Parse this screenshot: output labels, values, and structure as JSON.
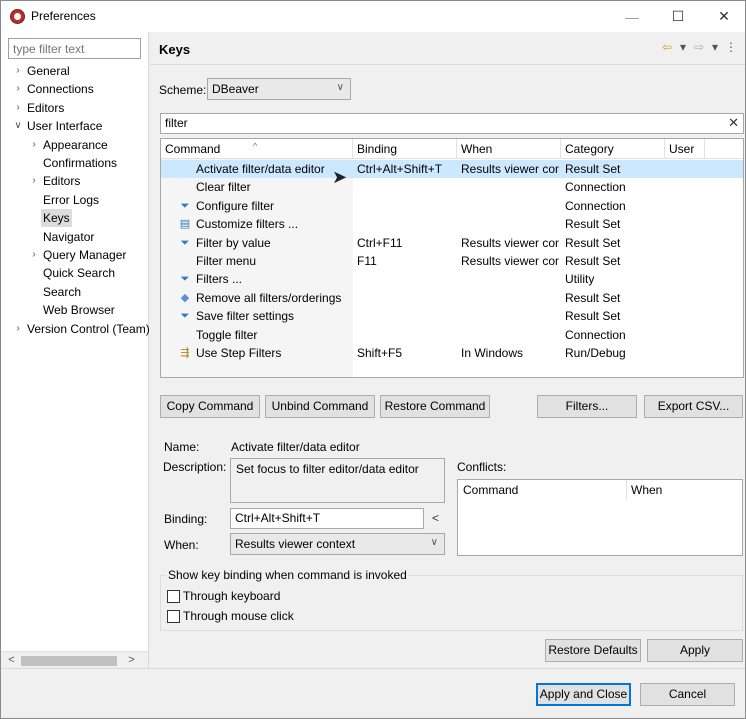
{
  "window": {
    "title": "Preferences"
  },
  "sidebar": {
    "filter_placeholder": "type filter text",
    "items": [
      {
        "label": "General",
        "twisty": ">",
        "depth": 0
      },
      {
        "label": "Connections",
        "twisty": ">",
        "depth": 0
      },
      {
        "label": "Editors",
        "twisty": ">",
        "depth": 0
      },
      {
        "label": "User Interface",
        "twisty": "v",
        "depth": 0
      },
      {
        "label": "Appearance",
        "twisty": ">",
        "depth": 1
      },
      {
        "label": "Confirmations",
        "twisty": "",
        "depth": 1
      },
      {
        "label": "Editors",
        "twisty": ">",
        "depth": 1
      },
      {
        "label": "Error Logs",
        "twisty": "",
        "depth": 1
      },
      {
        "label": "Keys",
        "twisty": "",
        "depth": 1,
        "selected": true
      },
      {
        "label": "Navigator",
        "twisty": "",
        "depth": 1
      },
      {
        "label": "Query Manager",
        "twisty": ">",
        "depth": 1
      },
      {
        "label": "Quick Search",
        "twisty": "",
        "depth": 1
      },
      {
        "label": "Search",
        "twisty": "",
        "depth": 1
      },
      {
        "label": "Web Browser",
        "twisty": "",
        "depth": 1
      },
      {
        "label": "Version Control (Team)",
        "twisty": ">",
        "depth": 0
      }
    ]
  },
  "page": {
    "title": "Keys",
    "scheme_label": "Scheme:",
    "scheme_value": "DBeaver",
    "filter_value": "filter"
  },
  "table": {
    "columns": [
      "Command",
      "Binding",
      "When",
      "Category",
      "User"
    ],
    "rows": [
      {
        "command": "Activate filter/data editor",
        "binding": "Ctrl+Alt+Shift+T",
        "when": "Results viewer context",
        "category": "Result Set",
        "user": "",
        "icon": "",
        "selected": true
      },
      {
        "command": "Clear filter",
        "binding": "",
        "when": "",
        "category": "Connection",
        "user": "",
        "icon": ""
      },
      {
        "command": "Configure filter",
        "binding": "",
        "when": "",
        "category": "Connection",
        "user": "",
        "icon": "funnel-icon"
      },
      {
        "command": "Customize filters ...",
        "binding": "",
        "when": "",
        "category": "Result Set",
        "user": "",
        "icon": "customize-filter-icon"
      },
      {
        "command": "Filter by value",
        "binding": "Ctrl+F11",
        "when": "Results viewer context",
        "category": "Result Set",
        "user": "",
        "icon": "funnel-value-icon"
      },
      {
        "command": "Filter menu",
        "binding": "F11",
        "when": "Results viewer context",
        "category": "Result Set",
        "user": "",
        "icon": ""
      },
      {
        "command": "Filters ...",
        "binding": "",
        "when": "",
        "category": "Utility",
        "user": "",
        "icon": "funnel-icon"
      },
      {
        "command": "Remove all filters/orderings",
        "binding": "",
        "when": "",
        "category": "Result Set",
        "user": "",
        "icon": "eraser-icon"
      },
      {
        "command": "Save filter settings",
        "binding": "",
        "when": "",
        "category": "Result Set",
        "user": "",
        "icon": "funnel-save-icon"
      },
      {
        "command": "Toggle filter",
        "binding": "",
        "when": "",
        "category": "Connection",
        "user": "",
        "icon": ""
      },
      {
        "command": "Use Step Filters",
        "binding": "Shift+F5",
        "when": "In Windows",
        "category": "Run/Debug",
        "user": "",
        "icon": "step-filter-icon"
      }
    ]
  },
  "buttons": {
    "copy": "Copy Command",
    "unbind": "Unbind Command",
    "restore": "Restore Command",
    "filters": "Filters...",
    "export": "Export CSV...",
    "restore_defaults": "Restore Defaults",
    "apply": "Apply",
    "apply_close": "Apply and Close",
    "cancel": "Cancel"
  },
  "details": {
    "name_label": "Name:",
    "name_value": "Activate filter/data editor",
    "description_label": "Description:",
    "description_value": "Set focus to filter editor/data editor",
    "binding_label": "Binding:",
    "binding_value": "Ctrl+Alt+Shift+T",
    "when_label": "When:",
    "when_value": "Results viewer context",
    "conflicts_label": "Conflicts:",
    "conflicts_columns": [
      "Command",
      "When"
    ]
  },
  "options": {
    "group_title": "Show key binding when command is invoked",
    "through_keyboard": "Through keyboard",
    "through_mouse": "Through mouse click",
    "through_keyboard_checked": false,
    "through_mouse_checked": false
  }
}
